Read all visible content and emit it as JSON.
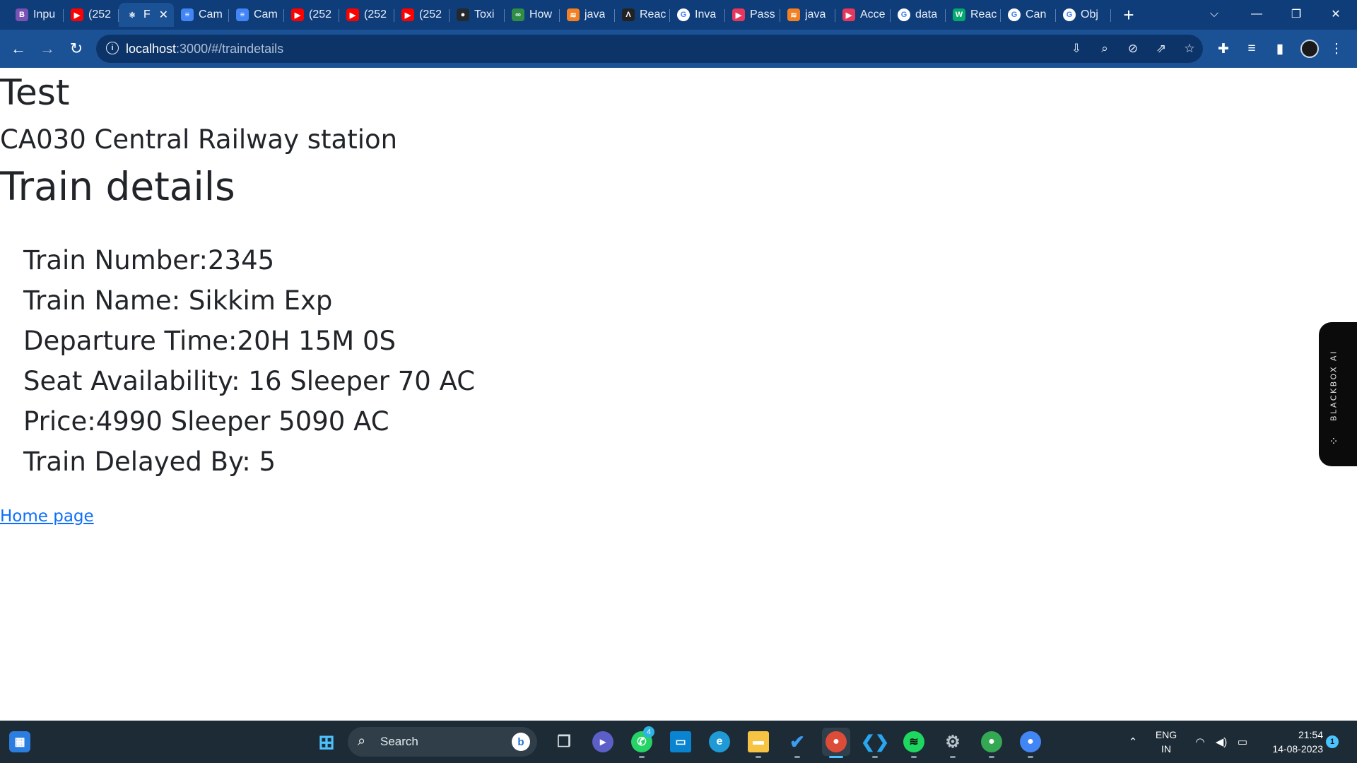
{
  "browser": {
    "tabs": [
      {
        "label": "Inpu",
        "icon": "bootstrap-icon",
        "color": "#7952b3",
        "glyph": "B"
      },
      {
        "label": "(252",
        "icon": "youtube-icon",
        "color": "#ff0000",
        "glyph": "▶"
      },
      {
        "label": "F",
        "icon": "react-icon",
        "color": "#1b5296",
        "glyph": "⚛",
        "active": true
      },
      {
        "label": "Cam",
        "icon": "docs-icon",
        "color": "#4285f4",
        "glyph": "≡"
      },
      {
        "label": "Cam",
        "icon": "docs-icon",
        "color": "#4285f4",
        "glyph": "≡"
      },
      {
        "label": "(252",
        "icon": "youtube-icon",
        "color": "#ff0000",
        "glyph": "▶"
      },
      {
        "label": "(252",
        "icon": "youtube-icon",
        "color": "#ff0000",
        "glyph": "▶"
      },
      {
        "label": "(252",
        "icon": "youtube-icon",
        "color": "#ff0000",
        "glyph": "▶"
      },
      {
        "label": "Toxi",
        "icon": "github-icon",
        "color": "#24292f",
        "glyph": "●"
      },
      {
        "label": "How",
        "icon": "geeksforgeeks-icon",
        "color": "#2f8d46",
        "glyph": "∞"
      },
      {
        "label": "java",
        "icon": "stackoverflow-icon",
        "color": "#f48024",
        "glyph": "≋"
      },
      {
        "label": "Reac",
        "icon": "react-icon",
        "color": "#222222",
        "glyph": "Λ"
      },
      {
        "label": "Inva",
        "icon": "google-icon",
        "color": "#ffffff",
        "glyph": "G"
      },
      {
        "label": "Pass",
        "icon": "app-icon",
        "color": "#e8365d",
        "glyph": "▶"
      },
      {
        "label": "java",
        "icon": "stackoverflow-icon",
        "color": "#f48024",
        "glyph": "≋"
      },
      {
        "label": "Acce",
        "icon": "app-icon",
        "color": "#e8365d",
        "glyph": "▶"
      },
      {
        "label": "data",
        "icon": "google-icon",
        "color": "#ffffff",
        "glyph": "G"
      },
      {
        "label": "Reac",
        "icon": "w3schools-icon",
        "color": "#04aa6d",
        "glyph": "W"
      },
      {
        "label": "Can",
        "icon": "google-icon",
        "color": "#ffffff",
        "glyph": "G"
      },
      {
        "label": "Obj",
        "icon": "google-icon",
        "color": "#ffffff",
        "glyph": "G"
      }
    ],
    "new_tab": "+",
    "url_host": "localhost",
    "url_path": ":3000/#/traindetails"
  },
  "page": {
    "title": "Test",
    "station": "CA030 Central Railway station",
    "section_title": "Train details",
    "details": [
      "Train Number:2345",
      "Train Name: Sikkim Exp",
      "Departure Time:20H 15M 0S",
      "Seat Availability: 16 Sleeper 70 AC",
      "Price:4990 Sleeper 5090 AC",
      "Train Delayed By: 5"
    ],
    "home_link": "Home page"
  },
  "side_panel": {
    "label": "BLACKBOX AI"
  },
  "taskbar": {
    "search_label": "Search",
    "whatsapp_badge": "4",
    "lang_line1": "ENG",
    "lang_line2": "IN",
    "time": "21:54",
    "date": "14-08-2023",
    "notification_count": "1"
  },
  "colors": {
    "chrome": "#1b5296",
    "tabstrip": "#0f3d7a",
    "link": "#0d6efd",
    "taskbar": "#1c2b36"
  }
}
